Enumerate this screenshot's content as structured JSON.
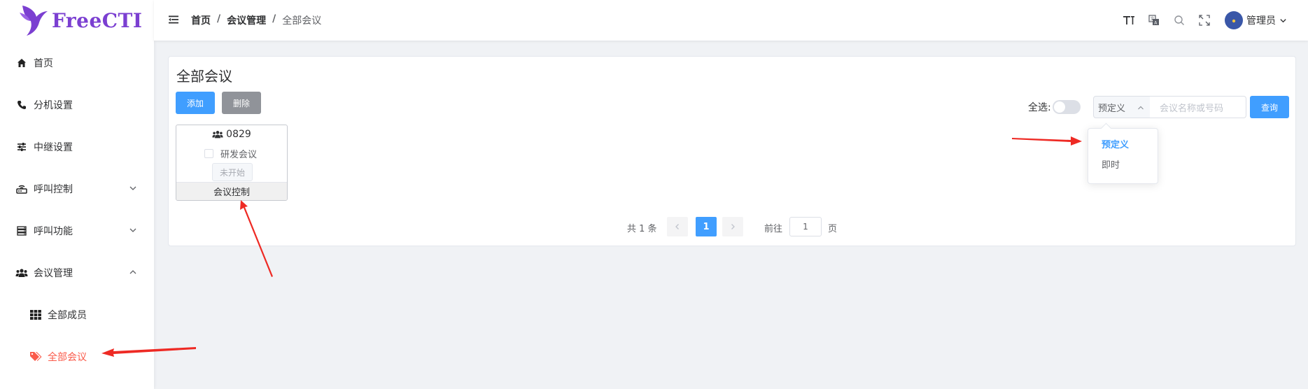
{
  "app": {
    "logo_text": "FreeCTI"
  },
  "sidebar": {
    "items": [
      {
        "label": "首页",
        "icon": "home-icon"
      },
      {
        "label": "分机设置",
        "icon": "phone-icon"
      },
      {
        "label": "中继设置",
        "icon": "sliders-icon"
      },
      {
        "label": "呼叫控制",
        "icon": "router-icon",
        "expanded": false
      },
      {
        "label": "呼叫功能",
        "icon": "server-icon",
        "expanded": false
      },
      {
        "label": "会议管理",
        "icon": "users-icon",
        "expanded": true
      },
      {
        "label": "全部成员",
        "icon": "grid-icon"
      },
      {
        "label": "全部会议",
        "icon": "tags-icon",
        "active": true
      }
    ]
  },
  "header": {
    "breadcrumb": [
      "首页",
      "会议管理",
      "全部会议"
    ],
    "separator": "/",
    "user_name": "管理员",
    "icons": [
      "font-size-icon",
      "translate-icon",
      "search-icon",
      "fullscreen-icon"
    ]
  },
  "main": {
    "title": "全部会议",
    "add_label": "添加",
    "delete_label": "删除",
    "select_all_label": "全选:",
    "select_all_on": false,
    "type_select_value": "预定义",
    "search_placeholder": "会议名称或号码",
    "query_label": "查询",
    "dropdown_options": [
      "预定义",
      "即时"
    ],
    "dropdown_selected": "预定义",
    "conferences": [
      {
        "number": "0829",
        "name": "研发会议",
        "status": "未开始",
        "control_label": "会议控制"
      }
    ],
    "pagination": {
      "total_text": "共 1 条",
      "current_page": "1",
      "goto_label": "前往",
      "goto_value": "1",
      "page_suffix": "页"
    }
  },
  "colors": {
    "primary": "#409eff",
    "danger_active": "#fa5a4a",
    "logo": "#7b3fd1",
    "annotation_arrow": "#ee2a24"
  }
}
